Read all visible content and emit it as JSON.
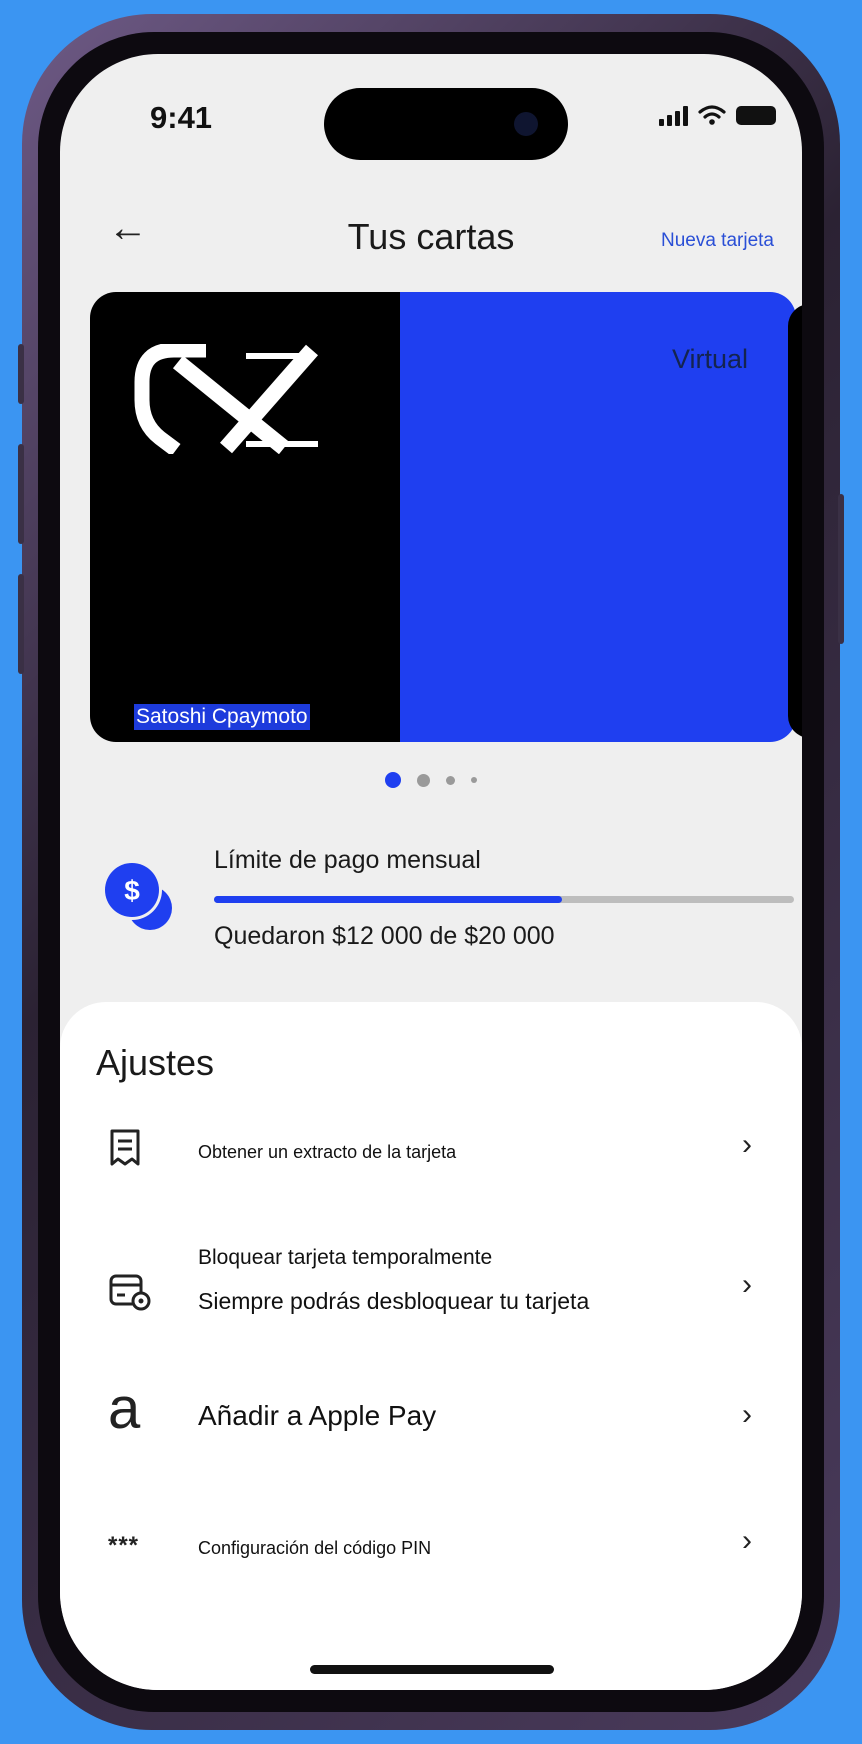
{
  "status": {
    "time": "9:41"
  },
  "header": {
    "back_icon": "←",
    "title": "Tus cartas",
    "new_card": "Nueva tarjeta"
  },
  "card": {
    "holder": "Satoshi Cpaymoto",
    "type": "Virtual",
    "colors": {
      "left": "#000000",
      "right": "#1f3ff0"
    }
  },
  "carousel": {
    "pages": 4,
    "active": 0
  },
  "limit": {
    "label": "Límite de pago mensual",
    "remaining_text": "Quedaron $12 000 de $20 000",
    "remaining": 12000,
    "total": 20000,
    "icon": "dollar-coin-icon",
    "icon_symbol": "$"
  },
  "settings": {
    "title": "Ajustes",
    "items": [
      {
        "icon": "receipt-icon",
        "label": "Obtener un extracto de la tarjeta",
        "chevron": "›"
      },
      {
        "icon": "card-lock-icon",
        "label": "Bloquear tarjeta temporalmente",
        "sublabel": "Siempre podrás desbloquear tu tarjeta",
        "chevron": "›"
      },
      {
        "icon": "apple-pay-icon",
        "icon_glyph": "a",
        "label": "Añadir a Apple Pay",
        "chevron": "›"
      },
      {
        "icon": "pin-asterisks-icon",
        "icon_glyph": "***",
        "label": "Configuración del código PIN",
        "chevron": "›"
      }
    ]
  },
  "accent_color": "#1f3ff0"
}
